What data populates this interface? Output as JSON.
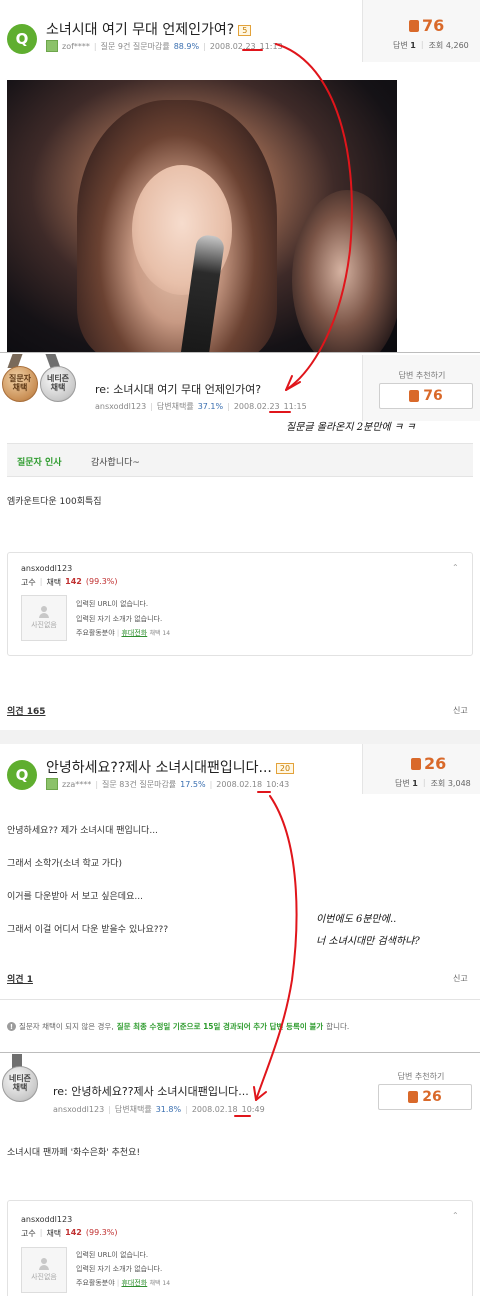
{
  "question1": {
    "badge": "Q",
    "title": "소녀시대 여기 무대 언제인가여?",
    "point": "5",
    "author": "zof****",
    "meta_stat": "질문 9건 질문마감률",
    "rate": "88.9%",
    "date": "2008.02.23",
    "time": "11:13",
    "score": "76",
    "answers_label": "답변",
    "answers_count": "1",
    "views_label": "조회",
    "views_count": "4,260"
  },
  "answer1": {
    "medal1": "질문자\n채택",
    "medal2": "네티즌\n채택",
    "title": "re: 소녀시대 여기 무대 언제인가여?",
    "author": "ansxoddl123",
    "meta_stat": "답변채택률",
    "rate": "37.1%",
    "date": "2008.02.23",
    "time": "11:15",
    "rec_label": "답변 추천하기",
    "rec_score": "76",
    "thanks_label": "질문자 인사",
    "thanks_text": "감사합니다~",
    "body": "엠카운트다운 100회특집",
    "opinions": "의견 165",
    "report": "신고"
  },
  "profile1": {
    "name": "ansxoddl123",
    "rank": "고수",
    "sel_label": "채택",
    "sel_count": "142",
    "sel_rate": "(99.3%)",
    "no_photo": "사진없음",
    "line1": "입력된 URL이 없습니다.",
    "line2": "입력된 자기 소개가 없습니다.",
    "line3": "주요활동분야",
    "field": "휴대전화",
    "field_sel": "채택 14"
  },
  "question2": {
    "badge": "Q",
    "title": "안녕하세요??제사 소녀시대팬입니다...",
    "point": "20",
    "author": "zza****",
    "meta_stat": "질문 83건 질문마감률",
    "rate": "17.5%",
    "date": "2008.02.18",
    "time": "10:43",
    "score": "26",
    "answers_label": "답변",
    "answers_count": "1",
    "views_label": "조회",
    "views_count": "3,048",
    "body_lines": [
      "안녕하세요?? 제가 소녀시대 팬입니다...",
      "그래서 소학가(소녀 학교 가다)",
      "이거를 다운받아 서 보고 싶은데요...",
      "그래서 이걸 어디서 다운 받을수 있나요???"
    ],
    "opinions": "의견 1",
    "report": "신고",
    "notice_a": "질문자 채택이 되지 않은 경우,",
    "notice_b": "질문 최종 수정일 기준으로 15일 경과되어 추가 답변 등록이 불가",
    "notice_c": "합니다."
  },
  "answer2": {
    "medal": "네티즌\n채택",
    "title": "re: 안녕하세요??제사 소녀시대팬입니다...",
    "author": "ansxoddl123",
    "meta_stat": "답변채택률",
    "rate": "31.8%",
    "date": "2008.02.18",
    "time": "10:49",
    "rec_label": "답변 추천하기",
    "rec_score": "26",
    "body": "소녀시대 팬까페 '화수은화' 추천요!"
  },
  "profile2": {
    "name": "ansxoddl123",
    "rank": "고수",
    "sel_label": "채택",
    "sel_count": "142",
    "sel_rate": "(99.3%)",
    "no_photo": "사진없음",
    "line1": "입력된 URL이 없습니다.",
    "line2": "입력된 자기 소개가 없습니다.",
    "line3": "주요활동분야",
    "field": "휴대전화",
    "field_sel": "채택 14"
  },
  "annotations": {
    "note1": "질문글 올라온지 2분만에 ㅋ ㅋ",
    "note2a": "이번에도 6분만에..",
    "note2b": "너 소녀시대만 검색하냐?",
    "ink_color": "#e0151b"
  }
}
